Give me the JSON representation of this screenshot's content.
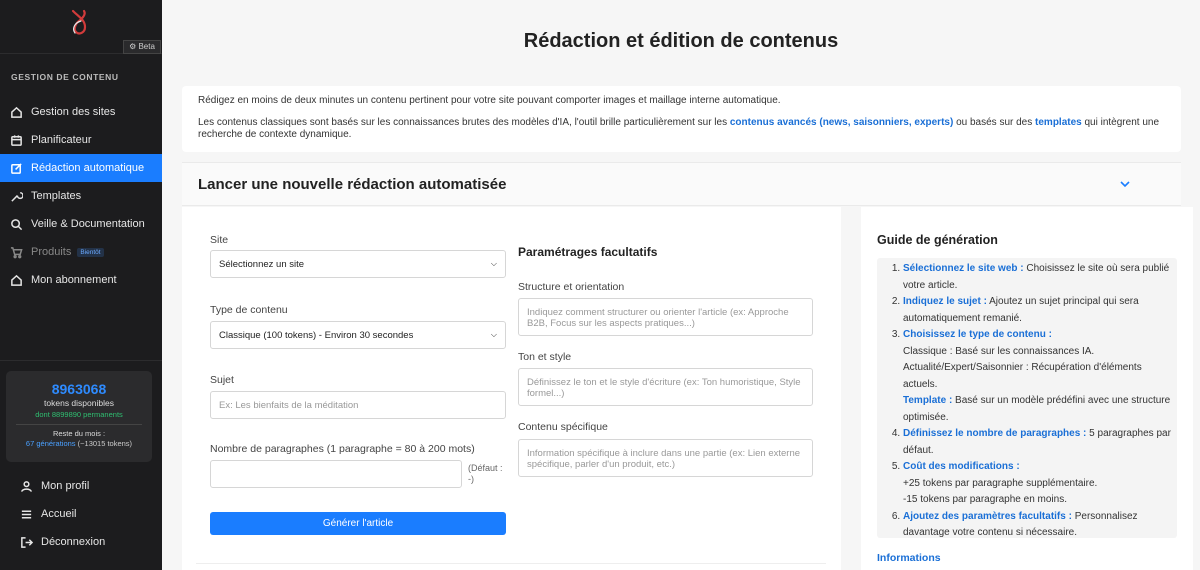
{
  "sidebar": {
    "beta": "Beta",
    "section_title": "GESTION DE CONTENU",
    "items": [
      {
        "label": "Gestion des sites",
        "icon": "home-icon"
      },
      {
        "label": "Planificateur",
        "icon": "calendar-icon"
      },
      {
        "label": "Rédaction automatique",
        "icon": "edit-icon",
        "active": true
      },
      {
        "label": "Templates",
        "icon": "wrench-icon"
      },
      {
        "label": "Veille & Documentation",
        "icon": "search-icon"
      },
      {
        "label": "Produits",
        "icon": "cart-icon",
        "badge": "Bientôt",
        "disabled": true
      },
      {
        "label": "Mon abonnement",
        "icon": "home-icon"
      }
    ],
    "tokens": {
      "count": "8963068",
      "label": "tokens disponibles",
      "permanent": "dont 8899890 permanents",
      "month_label": "Reste du mois :",
      "generations": "67 générations",
      "generations_tokens": "(~13015 tokens)"
    },
    "bottom": [
      {
        "label": "Mon profil",
        "icon": "user-icon"
      },
      {
        "label": "Accueil",
        "icon": "menu-icon"
      },
      {
        "label": "Déconnexion",
        "icon": "logout-icon"
      }
    ]
  },
  "main": {
    "title": "Rédaction et édition de contenus",
    "intro_1": "Rédigez en moins de deux minutes un contenu pertinent pour votre site pouvant comporter images et maillage interne automatique.",
    "intro_2a": "Les contenus classiques sont basés sur les connaissances brutes des modèles d'IA, l'outil brille particulièrement sur les ",
    "intro_2_link1": "contenus avancés (news, saisonniers, experts)",
    "intro_2b": " ou basés sur des ",
    "intro_2_link2": "templates",
    "intro_2c": " qui intègrent une recherche de contexte dynamique.",
    "launch_title": "Lancer une nouvelle rédaction automatisée"
  },
  "form": {
    "site_label": "Site",
    "site_value": "Sélectionnez un site",
    "type_label": "Type de contenu",
    "type_value": "Classique (100 tokens) - Environ 30 secondes",
    "subject_label": "Sujet",
    "subject_placeholder": "Ex: Les bienfaits de la méditation",
    "paragraphs_label": "Nombre de paragraphes (1 paragraphe = 80 à 200 mots)",
    "paragraphs_default": "(Défaut : -)",
    "generate_label": "Générer l'article",
    "options_title": "Paramétrages facultatifs",
    "structure_label": "Structure et orientation",
    "structure_placeholder": "Indiquez comment structurer ou orienter l'article (ex: Approche B2B, Focus sur les aspects pratiques...)",
    "tone_label": "Ton et style",
    "tone_placeholder": "Définissez le ton et le style d'écriture (ex: Ton humoristique, Style formel...)",
    "specific_label": "Contenu spécifique",
    "specific_placeholder": "Information spécifique à inclure dans une partie (ex: Lien externe spécifique, parler d'un produit, etc.)"
  },
  "guide": {
    "title": "Guide de génération",
    "steps": [
      {
        "head": "Sélectionnez le site web :",
        "text": " Choisissez le site où sera publié votre article."
      },
      {
        "head": "Indiquez le sujet :",
        "text": " Ajoutez un sujet principal qui sera automatiquement remanié."
      },
      {
        "head": "Choisissez le type de contenu :",
        "text": ""
      },
      {
        "head": "Définissez le nombre de paragraphes :",
        "text": " 5 paragraphes par défaut."
      },
      {
        "head": "Coût des modifications :",
        "text": ""
      },
      {
        "head": "Ajoutez des paramètres facultatifs :",
        "text": " Personnalisez davantage votre contenu si nécessaire."
      }
    ],
    "type_classic": "Classique : Basé sur les connaissances IA.",
    "type_actu": "Actualité/Expert/Saisonnier : Récupération d'éléments actuels.",
    "type_template_head": "Template :",
    "type_template_text": " Basé sur un modèle prédéfini avec une structure optimisée.",
    "cost_plus": "+25 tokens par paragraphe supplémentaire.",
    "cost_minus": "-15 tokens par paragraphe en moins.",
    "info_link": "Informations"
  }
}
